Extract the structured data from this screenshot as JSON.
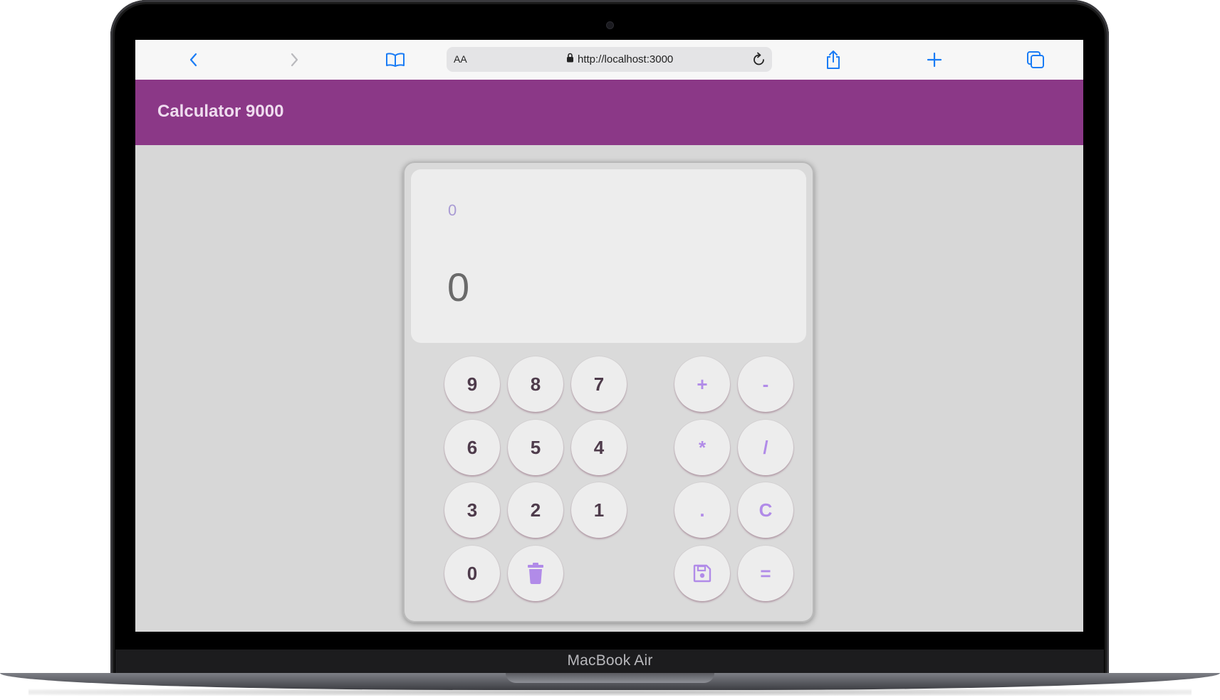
{
  "browser": {
    "reader_label": "AA",
    "url": "http://localhost:3000",
    "icons": {
      "back": "chevron-left-icon",
      "forward": "chevron-right-icon",
      "bookmarks": "book-icon",
      "lock": "lock-icon",
      "reload": "reload-icon",
      "share": "share-icon",
      "new_tab": "plus-icon",
      "tabs": "tabs-icon"
    },
    "accent_color": "#1a7cf5"
  },
  "device": {
    "model_label": "MacBook Air"
  },
  "app": {
    "title": "Calculator 9000",
    "header_color": "#8b3887"
  },
  "calculator": {
    "display": {
      "previous": "0",
      "current": "0"
    },
    "number_keys": {
      "k9": "9",
      "k8": "8",
      "k7": "7",
      "k6": "6",
      "k5": "5",
      "k4": "4",
      "k3": "3",
      "k2": "2",
      "k1": "1",
      "k0": "0"
    },
    "operator_keys": {
      "plus": "+",
      "minus": "-",
      "multiply": "*",
      "divide": "/",
      "decimal": ".",
      "clear": "C",
      "equals": "="
    },
    "icon_keys": {
      "delete": "trash-icon",
      "save": "save-icon"
    },
    "operator_color": "#b18be8",
    "number_color": "#4e3b4b"
  }
}
